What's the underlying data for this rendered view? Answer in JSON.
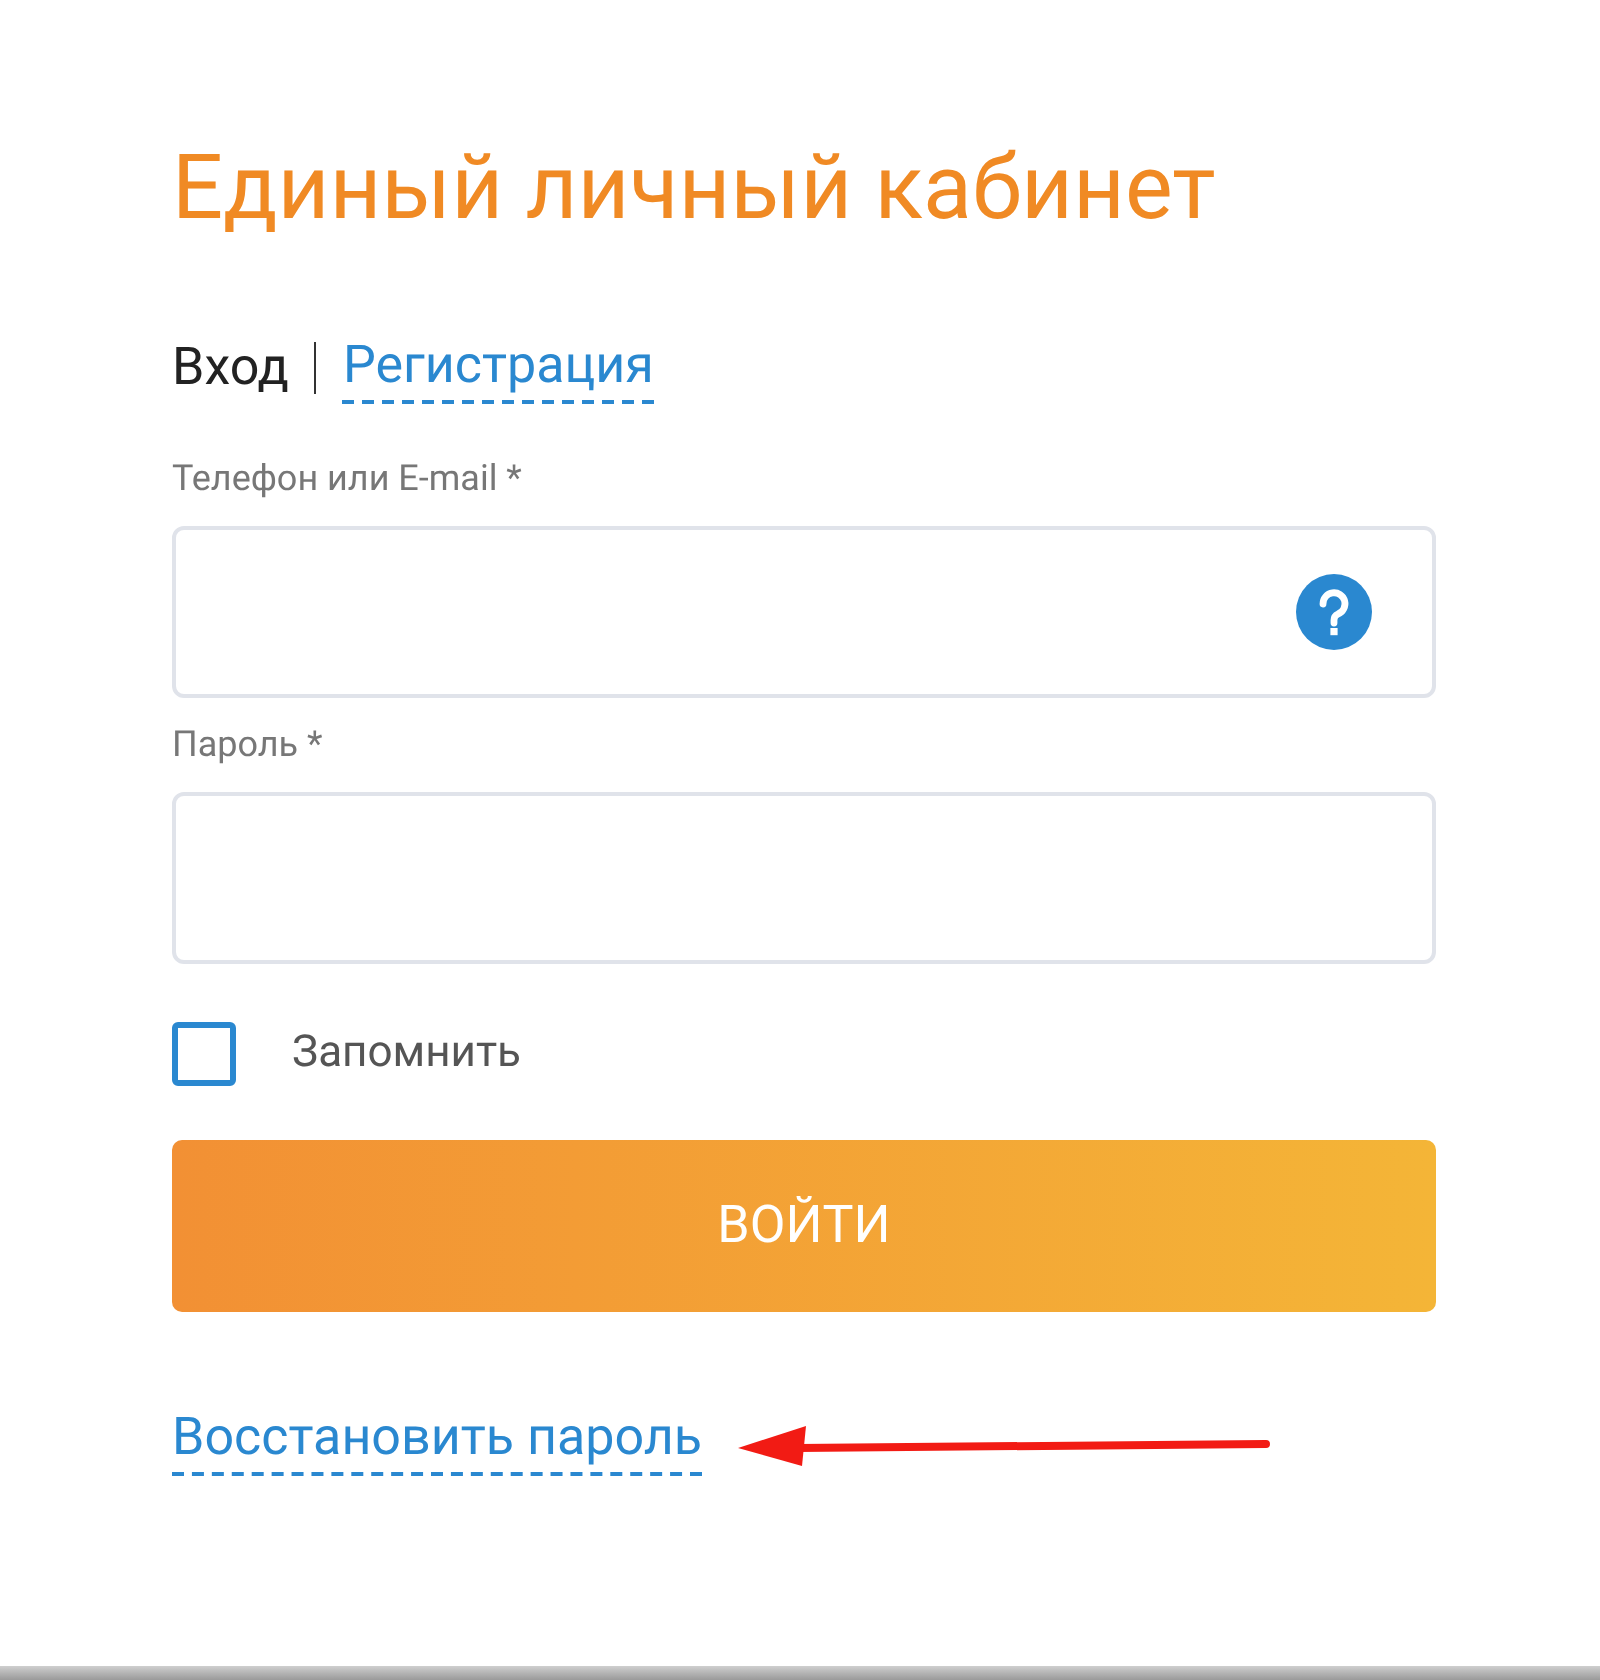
{
  "title": "Единый личный кабинет",
  "tabs": [
    {
      "label": "Вход",
      "selected": true
    },
    {
      "label": "Регистрация",
      "selected": false
    }
  ],
  "fields": [
    {
      "label": "Телефон или E-mail *",
      "help": true
    },
    {
      "label": "Пароль *",
      "help": false
    }
  ],
  "remember": {
    "label": "Запомнить",
    "checked": false
  },
  "submit": "ВОЙТИ",
  "restore_link": "Восстановить пароль"
}
